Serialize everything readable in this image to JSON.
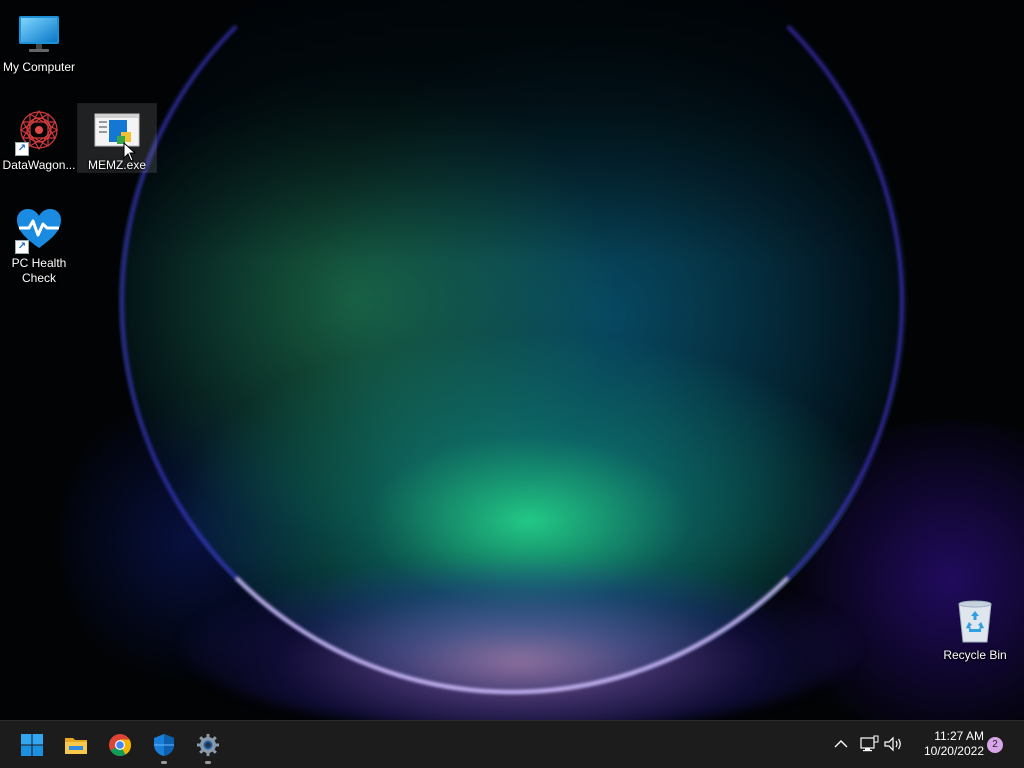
{
  "desktop": {
    "icons": [
      {
        "label": "My Computer",
        "icon": "monitor-icon"
      },
      {
        "label": "DataWagon...",
        "icon": "datawagon-icon",
        "shortcut": true
      },
      {
        "label": "MEMZ.exe",
        "icon": "exe-window-icon",
        "selected": true
      },
      {
        "label": "PC Health Check",
        "icon": "health-heart-icon",
        "shortcut": true
      },
      {
        "label": "Recycle Bin",
        "icon": "recycle-bin-icon"
      }
    ]
  },
  "taskbar": {
    "pinned": [
      {
        "name": "start",
        "icon": "windows-logo-icon"
      },
      {
        "name": "file-explorer",
        "icon": "folder-icon"
      },
      {
        "name": "chrome",
        "icon": "chrome-icon"
      },
      {
        "name": "defender",
        "icon": "shield-icon",
        "running": true
      },
      {
        "name": "settings",
        "icon": "gear-icon",
        "running": true
      }
    ],
    "tray": {
      "icons": [
        "chevron-up-icon",
        "network-icon",
        "volume-icon"
      ],
      "time": "11:27 AM",
      "date": "10/20/2022",
      "notification_count": "2"
    }
  },
  "colors": {
    "taskbar_bg": "#1c1c1c",
    "accent_blue": "#0078d4",
    "notification_badge": "#d8a6e8"
  }
}
